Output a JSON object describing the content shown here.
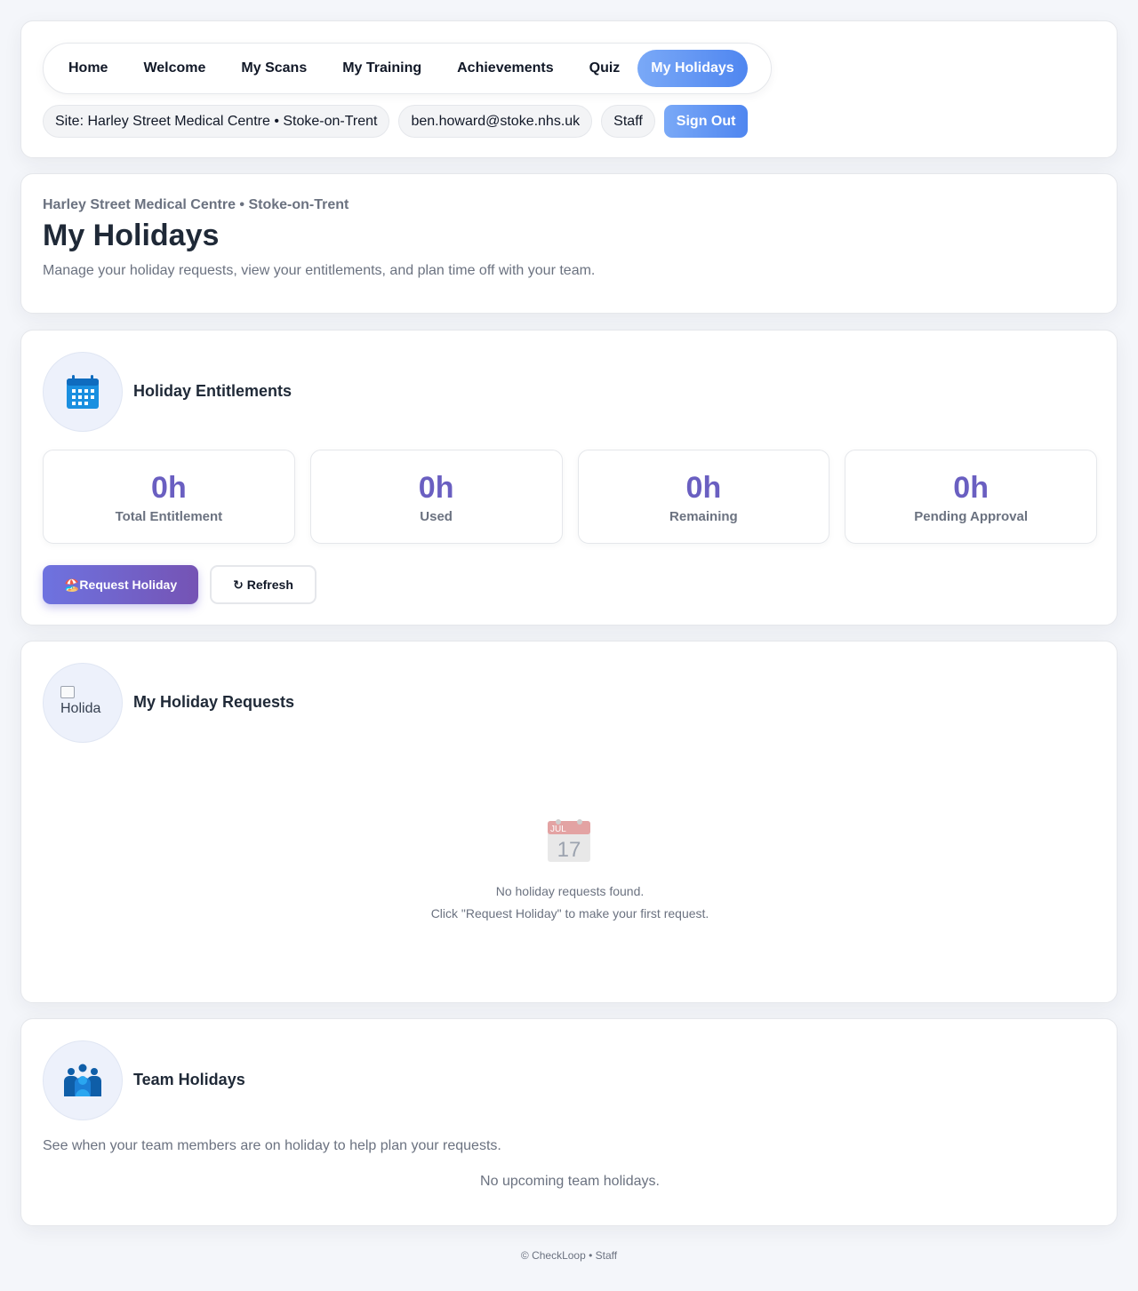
{
  "nav": {
    "items": [
      {
        "label": "Home",
        "active": false
      },
      {
        "label": "Welcome",
        "active": false
      },
      {
        "label": "My Scans",
        "active": false
      },
      {
        "label": "My Training",
        "active": false
      },
      {
        "label": "Achievements",
        "active": false
      },
      {
        "label": "Quiz",
        "active": false
      },
      {
        "label": "My Holidays",
        "active": true
      }
    ]
  },
  "session": {
    "site": "Site: Harley Street Medical Centre • Stoke-on-Trent",
    "email": "ben.howard@stoke.nhs.uk",
    "role": "Staff",
    "signout_label": "Sign Out"
  },
  "header": {
    "site_name": "Harley Street Medical Centre • Stoke-on-Trent",
    "title": "My Holidays",
    "description": "Manage your holiday requests, view your entitlements, and plan time off with your team."
  },
  "entitlements": {
    "title": "Holiday Entitlements",
    "icon": "calendar-icon",
    "stats": [
      {
        "value": "0h",
        "label": "Total Entitlement"
      },
      {
        "value": "0h",
        "label": "Used"
      },
      {
        "value": "0h",
        "label": "Remaining"
      },
      {
        "value": "0h",
        "label": "Pending Approval"
      }
    ],
    "request_button": "🏖️Request Holiday",
    "refresh_button": "↻ Refresh"
  },
  "requests": {
    "title": "My Holiday Requests",
    "icon_alt": "Holida",
    "empty_icon": "calendar-17-icon",
    "empty_line1": "No holiday requests found.",
    "empty_line2": "Click \"Request Holiday\" to make your first request."
  },
  "team": {
    "title": "Team Holidays",
    "icon": "team-icon",
    "description": "See when your team members are on holiday to help plan your requests.",
    "empty": "No upcoming team holidays."
  },
  "footer": "© CheckLoop • Staff",
  "colors": {
    "accent_blue": "#4f86f0",
    "stat_purple": "#6a5fc1",
    "primary_gradient_start": "#6e73e0",
    "primary_gradient_end": "#7553b4"
  }
}
